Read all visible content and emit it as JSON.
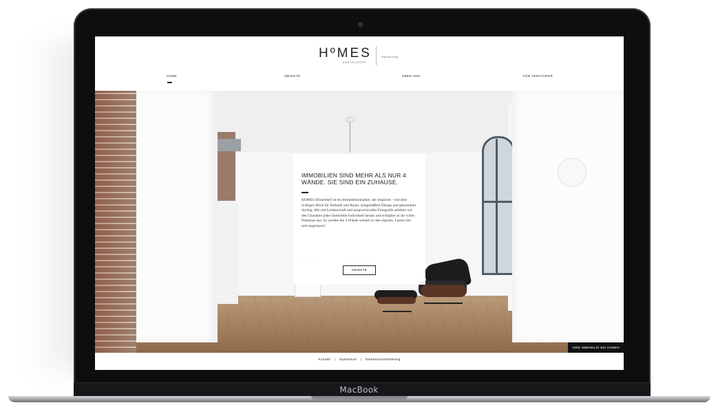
{
  "device": {
    "brand": "MacBook"
  },
  "site": {
    "logo": "HºMES",
    "logo_sub": "DÜSSELDORF",
    "tagline": "Inspired living"
  },
  "nav": {
    "items": [
      "HOME",
      "OBJEKTE",
      "ÜBER UNS",
      "FÜR VERKÄUFER"
    ],
    "active": "HOME"
  },
  "hero": {
    "title": "IMMOBILIEN SIND MEHR ALS NUR 4 WÄNDE. SIE SIND EIN ZUHAUSE.",
    "body": "HOMES Düsseldorf ist ein Immobilienmakler, der inspiriert – mit dem richtigen Blick für Ästhetik und Raum, zeitgemäßem Design und gekonntem Styling. Mit viel Leidenschaft und anspruchsvoller Fotografie arbeiten wir den Charakter jeder Immobilie individuell heraus und schöpfen so ihr volles Potenzial aus. So werden die 4 Wände schnell zu den eigenen. Lassen Sie sich inspirieren!",
    "button": "OBJEKTE",
    "badge": "IHRE IMMOBILIE BEI HOMES"
  },
  "footer": {
    "links": [
      "Kontakt",
      "Impressum",
      "Datenschutzerklärung"
    ],
    "separator": "|"
  }
}
